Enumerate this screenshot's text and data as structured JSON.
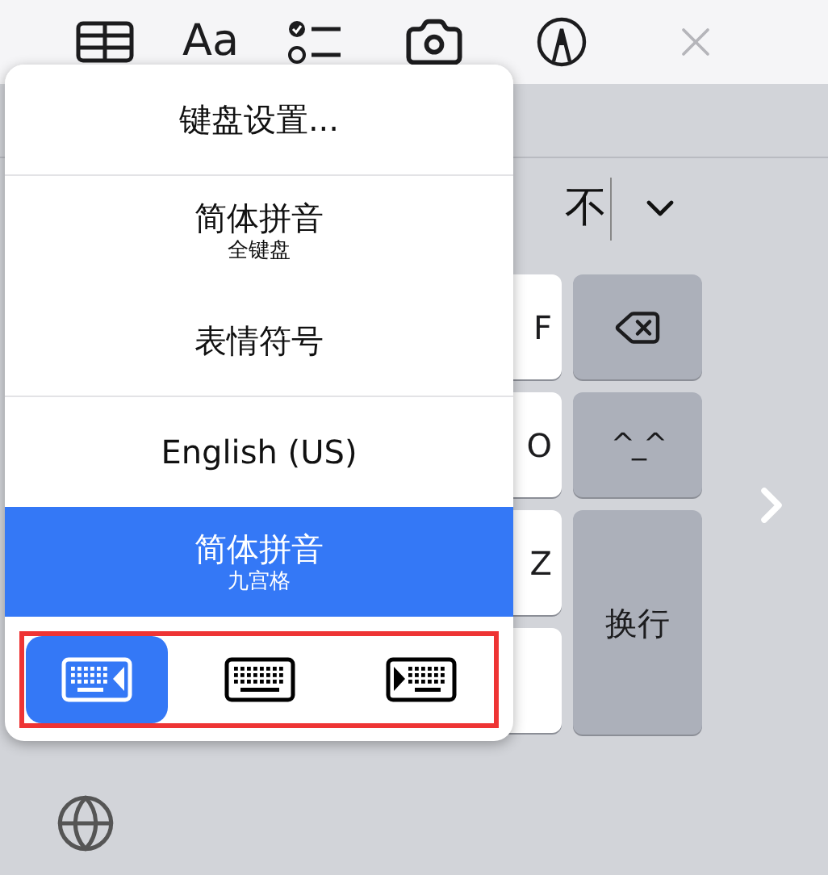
{
  "toolbar": {
    "format_label": "Aa"
  },
  "candidate_bar": {
    "candidate": "不"
  },
  "letter_keys": [
    "F",
    "O",
    "Z"
  ],
  "action_keys": [
    {
      "kind": "delete"
    },
    {
      "kind": "emoticon",
      "label": "^_^"
    },
    {
      "kind": "return",
      "label": "换行"
    }
  ],
  "menu": {
    "items": [
      {
        "label": "键盘设置...",
        "selected": false,
        "divider_after": true
      },
      {
        "label": "简体拼音",
        "sublabel": "全键盘",
        "selected": false,
        "divider_after": false
      },
      {
        "label": "表情符号",
        "selected": false,
        "divider_after": true
      },
      {
        "label": "English (US)",
        "selected": false,
        "divider_after": false
      },
      {
        "label": "简体拼音",
        "sublabel": "九宫格",
        "selected": true,
        "divider_after": false
      }
    ],
    "modes": [
      {
        "kind": "dock-left",
        "selected": true
      },
      {
        "kind": "full",
        "selected": false
      },
      {
        "kind": "dock-right",
        "selected": false
      }
    ]
  }
}
